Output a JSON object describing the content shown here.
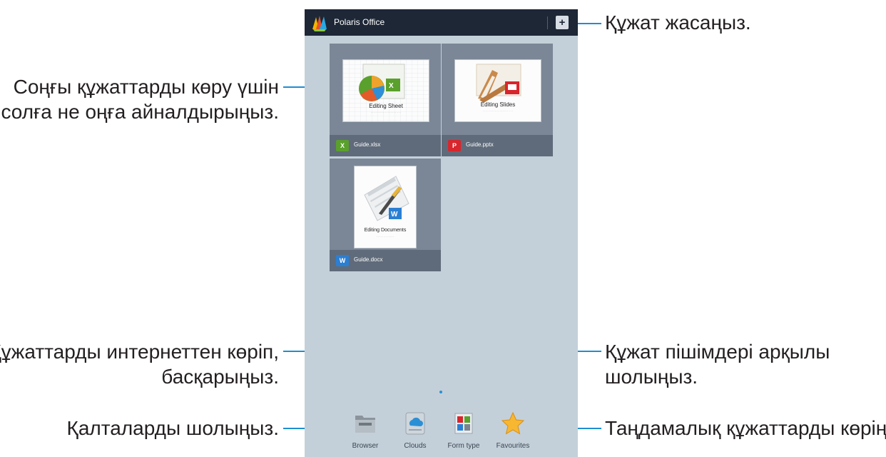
{
  "app": {
    "title": "Polaris Office"
  },
  "documents": [
    {
      "thumb_title": "Editing Sheet",
      "filename": "Guide.xlsx",
      "icon": "excel-icon",
      "color": "#5aa02c"
    },
    {
      "thumb_title": "Editing Slides",
      "filename": "Guide.pptx",
      "icon": "powerpoint-icon",
      "color": "#d9252c"
    },
    {
      "thumb_title": "Editing Documents",
      "filename": "Guide.docx",
      "icon": "word-icon",
      "color": "#2b7fd3"
    }
  ],
  "dock": [
    {
      "label": "Browser",
      "icon": "folder-icon"
    },
    {
      "label": "Clouds",
      "icon": "cloud-icon"
    },
    {
      "label": "Form type",
      "icon": "form-type-icon"
    },
    {
      "label": "Favourites",
      "icon": "star-icon"
    }
  ],
  "callouts": {
    "create": "Құжат жасаңыз.",
    "scroll_line1": "Соңғы құжаттарды көру үшін",
    "scroll_line2": "солға не оңға айналдырыңыз.",
    "clouds_line1": "Құжаттарды интернеттен көріп,",
    "clouds_line2": "басқарыңыз.",
    "browser": "Қалталарды шолыңыз.",
    "formtype_line1": "Құжат пішімдері арқылы",
    "formtype_line2": "шолыңыз.",
    "favourites": "Таңдамалық құжаттарды көріңіз."
  },
  "colors": {
    "accent": "#1f8ed0",
    "titlebar": "#1d2736",
    "background": "#c4d0d9"
  }
}
